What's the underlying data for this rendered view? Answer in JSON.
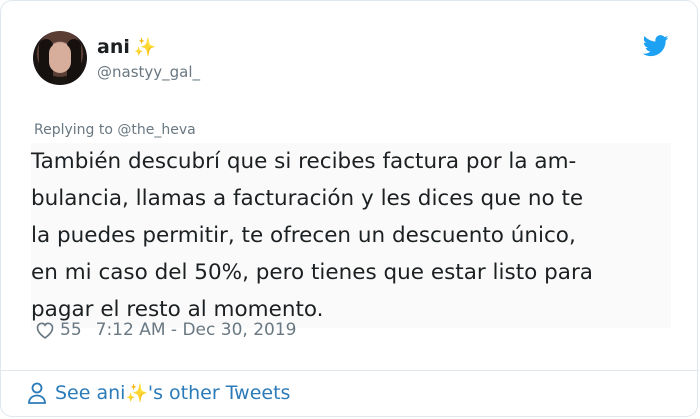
{
  "author": {
    "name": "ani",
    "name_emoji": "✨",
    "handle": "@nastyy_gal_"
  },
  "reply_context": "Replying to @the_heva",
  "tweet_lines": [
    "También descubrí que si recibes factura por la am-",
    "bulancia, llamas a facturación y les dices que no te",
    "la puedes permitir, te ofrecen un descuento único,",
    "en mi caso del 50%, pero tienes que estar listo para",
    "pagar el resto al momento."
  ],
  "meta": {
    "likes": "55",
    "timestamp": "7:12 AM - Dec 30, 2019"
  },
  "footer": {
    "prefix": "See ani",
    "emoji": "✨",
    "suffix": "'s other Tweets"
  },
  "icons": {
    "bird": "twitter-bird-icon",
    "heart": "heart-icon",
    "person": "person-icon"
  },
  "colors": {
    "link": "#2b7bb9",
    "secondary_text": "#697882",
    "twitter_blue": "#1da1f2",
    "sparkle": "#f5c518"
  }
}
